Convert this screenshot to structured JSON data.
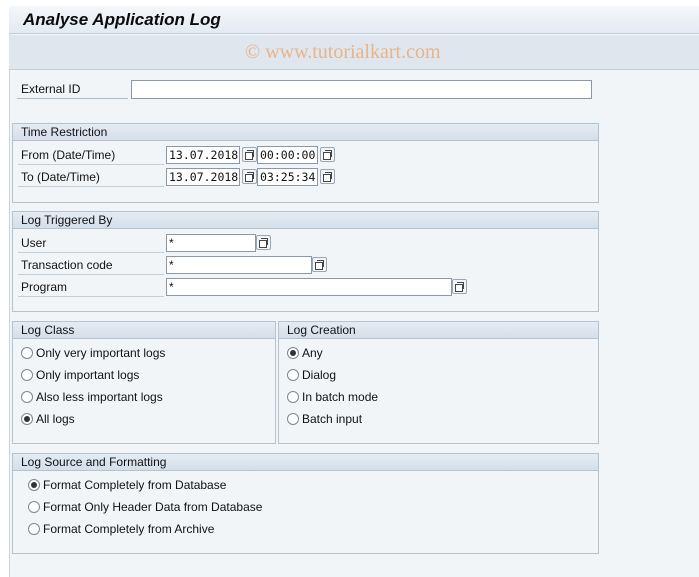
{
  "window": {
    "title": "Analyse Application Log",
    "watermark": "© www.tutorialkart.com"
  },
  "external_id": {
    "label": "External ID",
    "value": ""
  },
  "time_restriction": {
    "title": "Time Restriction",
    "from_label": "From (Date/Time)",
    "from_date": "13.07.2018",
    "from_time": "00:00:00",
    "to_label": "To (Date/Time)",
    "to_date": "13.07.2018",
    "to_time": "03:25:34"
  },
  "log_triggered_by": {
    "title": "Log Triggered By",
    "user_label": "User",
    "user_value": "*",
    "tcode_label": "Transaction code",
    "tcode_value": "*",
    "program_label": "Program",
    "program_value": "*"
  },
  "log_class": {
    "title": "Log Class",
    "options": [
      "Only very important logs",
      "Only important logs",
      "Also less important logs",
      "All logs"
    ],
    "selected": "All logs"
  },
  "log_creation": {
    "title": "Log Creation",
    "options": [
      "Any",
      "Dialog",
      "In batch mode",
      "Batch input"
    ],
    "selected": "Any"
  },
  "log_source": {
    "title": "Log Source and Formatting",
    "options": [
      "Format Completely from Database",
      "Format Only Header Data from Database",
      "Format Completely from Archive"
    ],
    "selected": "Format Completely from Database"
  }
}
